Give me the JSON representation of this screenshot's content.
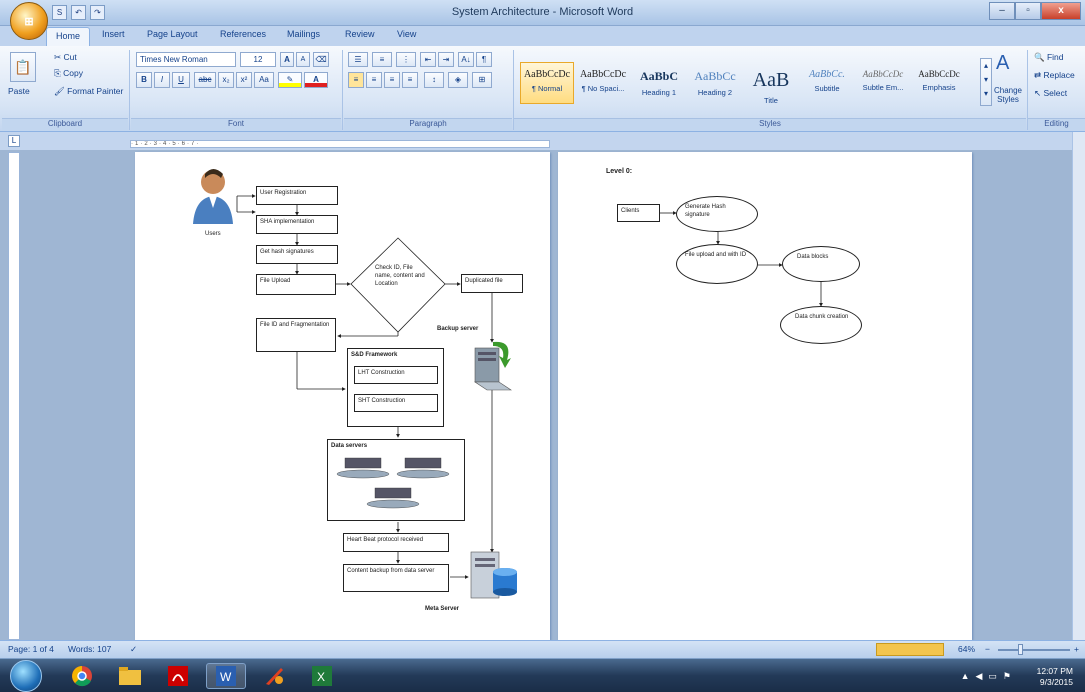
{
  "window": {
    "title": "System Architecture - Microsoft Word",
    "minimize": "–",
    "maximize": "▫",
    "close": "x"
  },
  "office_button": "⊞",
  "qat": [
    "S",
    "↶",
    "↷"
  ],
  "tabs": [
    "Home",
    "Insert",
    "Page Layout",
    "References",
    "Mailings",
    "Review",
    "View"
  ],
  "active_tab": "Home",
  "ribbon": {
    "clipboard": {
      "paste": "Paste",
      "cut": "Cut",
      "copy": "Copy",
      "format_painter": "Format Painter",
      "label": "Clipboard"
    },
    "font": {
      "name": "Times New Roman",
      "size": "12",
      "label": "Font",
      "buttons": [
        "B",
        "I",
        "U",
        "abc",
        "x₂",
        "x²",
        "Aa"
      ],
      "grow": "A",
      "shrink": "A"
    },
    "paragraph": {
      "label": "Paragraph",
      "pilcrow": "¶",
      "sort": "A↓"
    },
    "styles": {
      "label": "Styles",
      "items": [
        {
          "preview": "AaBbCcDc",
          "name": "¶ Normal",
          "selected": true
        },
        {
          "preview": "AaBbCcDc",
          "name": "¶ No Spaci...",
          "selected": false
        },
        {
          "preview": "AaBbC",
          "name": "Heading 1",
          "selected": false
        },
        {
          "preview": "AaBbCc",
          "name": "Heading 2",
          "selected": false
        },
        {
          "preview": "AaB",
          "name": "Title",
          "selected": false
        },
        {
          "preview": "AaBbCc.",
          "name": "Subtitle",
          "selected": false
        },
        {
          "preview": "AaBbCcDc",
          "name": "Subtle Em...",
          "selected": false
        },
        {
          "preview": "AaBbCcDc",
          "name": "Emphasis",
          "selected": false
        }
      ],
      "change_styles": "Change Styles"
    },
    "editing": {
      "find": "Find",
      "replace": "Replace",
      "select": "Select",
      "label": "Editing"
    }
  },
  "ruler": {
    "corner": "L",
    "marks": "·1·2·3·4·5·6·7·"
  },
  "page1": {
    "users": "Users",
    "user_registration": "User Registration",
    "sha": "SHA implementation",
    "get_hash": "Get hash signatures",
    "file_upload": "File Upload",
    "check_id": "Check ID, File name, content and Location",
    "duplicated": "Duplicated file",
    "backup_server": "Backup server",
    "file_id": "File ID and Fragmentation",
    "sd_framework": "S&D Framework",
    "lht": "LHT Construction",
    "sht": "SHT Construction",
    "data_servers": "Data servers",
    "heart_beat": "Heart Beat protocol received",
    "content_backup": "Content backup from data server",
    "meta_server": "Meta Server"
  },
  "page2": {
    "level": "Level 0:",
    "clients": "Clients",
    "generate_hash": "Generate Hash signature",
    "file_upload_id": "File upload and with ID",
    "data_blocks": "Data blocks",
    "data_chunk": "Data chunk creation"
  },
  "status": {
    "page": "Page: 1 of 4",
    "words": "Words: 107",
    "zoom": "64%",
    "minus": "−",
    "plus": "+"
  },
  "taskbar": {
    "time": "12:07 PM",
    "date": "9/3/2015"
  }
}
